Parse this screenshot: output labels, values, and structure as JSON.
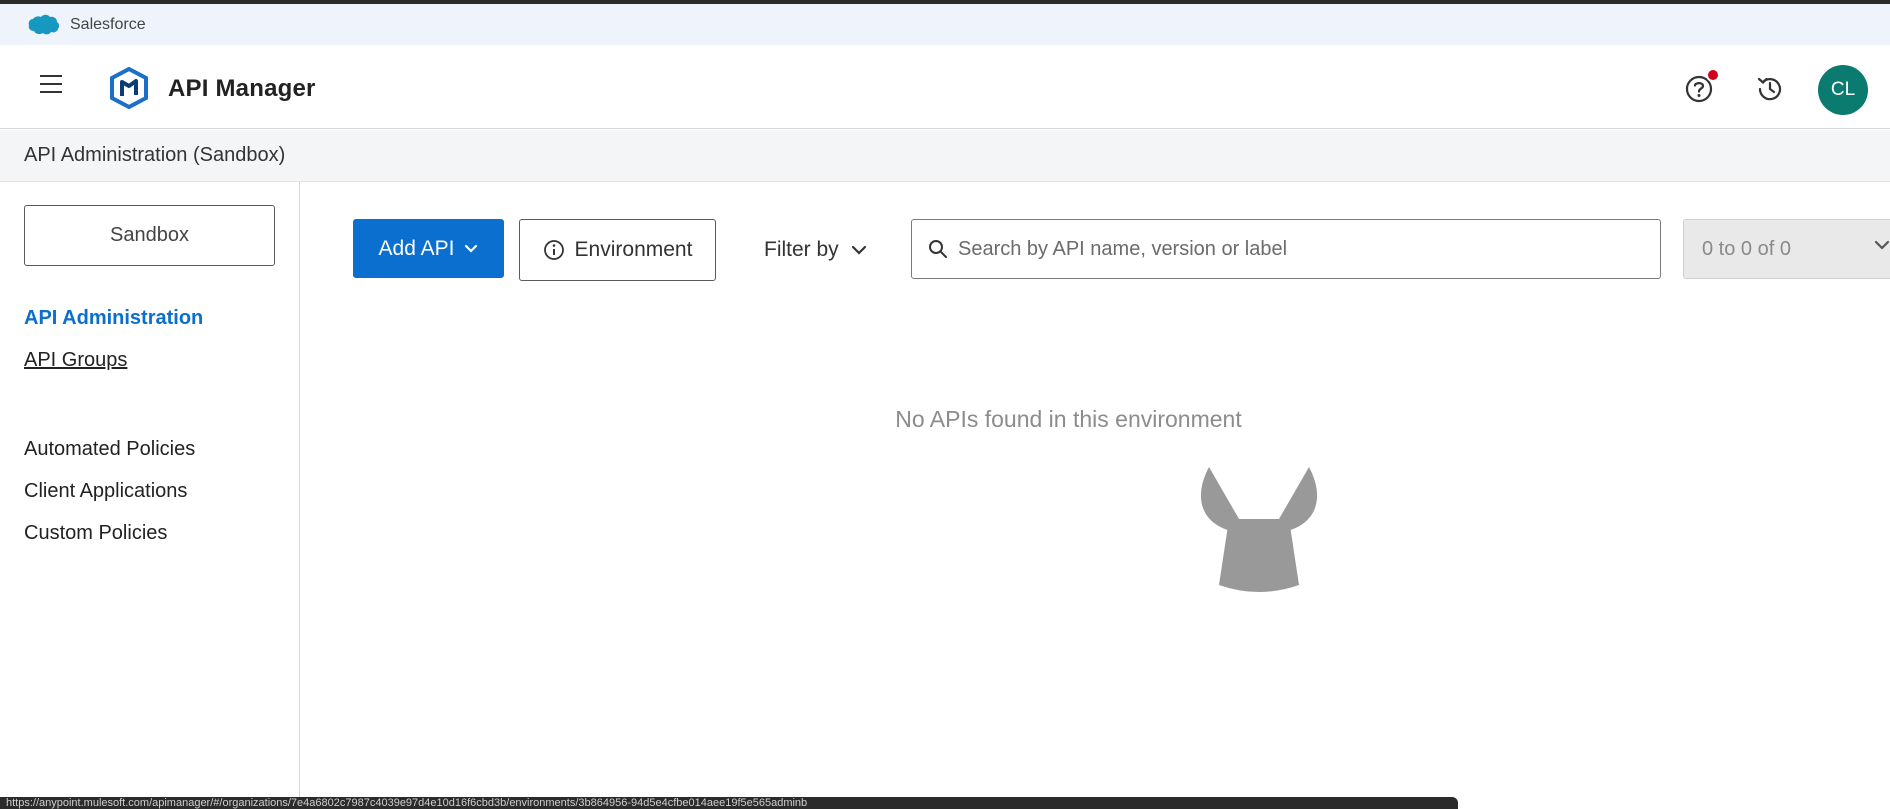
{
  "salesforce_bar": {
    "title": "Salesforce",
    "icon": "salesforce-cloud-icon",
    "color": "#1798c1"
  },
  "header": {
    "menu_icon": "hamburger-menu-icon",
    "logo_icon": "api-manager-logo-icon",
    "app_title": "API Manager",
    "help_icon": "help-question-icon",
    "notification_color": "#d0021b",
    "history_icon": "history-clock-icon",
    "avatar_initials": "CL",
    "avatar_color": "#0b7b70"
  },
  "subheader": {
    "title": "API Administration (Sandbox)"
  },
  "sidebar": {
    "environment_label": "Sandbox",
    "nav_primary": [
      {
        "label": "API Administration",
        "active": true
      },
      {
        "label": "API Groups",
        "active": false
      }
    ],
    "nav_secondary": [
      {
        "label": "Automated Policies"
      },
      {
        "label": "Client Applications"
      },
      {
        "label": "Custom Policies"
      }
    ]
  },
  "toolbar": {
    "add_api_label": "Add API",
    "environment_label": "Environment",
    "filter_label": "Filter by",
    "search_placeholder": "Search by API name, version or label",
    "pagination_text": "0 to 0 of 0",
    "accent_color": "#0a6fce"
  },
  "empty_state": {
    "message": "No APIs found in this environment",
    "illustration_icon": "empty-state-creature-icon"
  },
  "status_bar": {
    "url_text": "https://anypoint.mulesoft.com/apimanager/#/organizations/7e4a6802c7987c4039e97d4e10d16f6cbd3b/environments/3b864956-94d5e4cfbe014aee19f5e565adminb"
  }
}
